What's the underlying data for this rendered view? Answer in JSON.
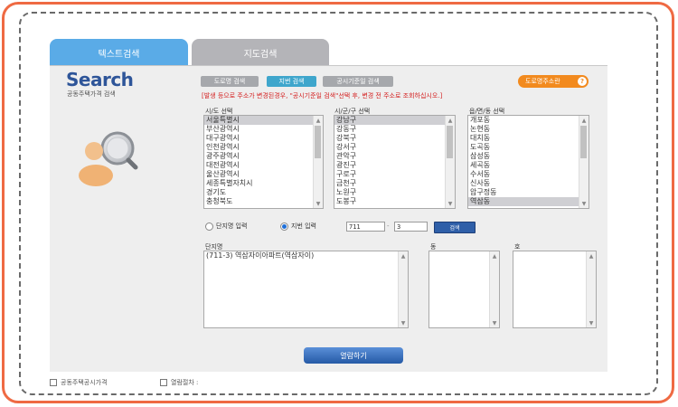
{
  "tabs": {
    "text_search": "텍스트검색",
    "map_search": "지도검색"
  },
  "logo": {
    "title": "Search",
    "subtitle": "공동주택가격 검색"
  },
  "toolbar": {
    "road_search": "도로명 검색",
    "lot_search": "지번 검색",
    "notice_date_search": "공시기준일 검색",
    "road_address": "도로명주소란",
    "help": "?"
  },
  "notice": "[발생 등으로 주소가 변경된경우, \"공시기준일 검색\"선택 후, 변경 전 주소로 조회하십시오.]",
  "columns": {
    "sido_label": "시/도 선택",
    "sigungu_label": "시/군/구 선택",
    "eupmyeondong_label": "읍/면/동 선택"
  },
  "sido_list": [
    "서울특별시",
    "부산광역시",
    "대구광역시",
    "인천광역시",
    "광주광역시",
    "대전광역시",
    "울산광역시",
    "세종특별자치시",
    "경기도",
    "충청북도"
  ],
  "sido_selected": 0,
  "sigungu_list": [
    "강남구",
    "강동구",
    "강북구",
    "강서구",
    "관악구",
    "광진구",
    "구로구",
    "금천구",
    "노원구",
    "도봉구"
  ],
  "sigungu_selected": 0,
  "dong_list": [
    "개포동",
    "논현동",
    "대치동",
    "도곡동",
    "삼성동",
    "세곡동",
    "수서동",
    "신사동",
    "압구정동",
    "역삼동"
  ],
  "dong_selected": 9,
  "input_mode": {
    "danji_label": "단지명 입력",
    "jibun_label": "지번 입력",
    "selected": "jibun"
  },
  "jibun_input": {
    "main": "711",
    "sub": "3",
    "separator": "-",
    "search_button": "검색"
  },
  "results": {
    "danji_label": "단지명",
    "dong_label": "동",
    "ho_label": "호",
    "danji_items": [
      "(711-3) 역삼자이아파트(역삼자이)"
    ]
  },
  "view_button": "열람하기",
  "footer": {
    "link1": "공동주택공시가격",
    "link2": "열람절차 :"
  }
}
